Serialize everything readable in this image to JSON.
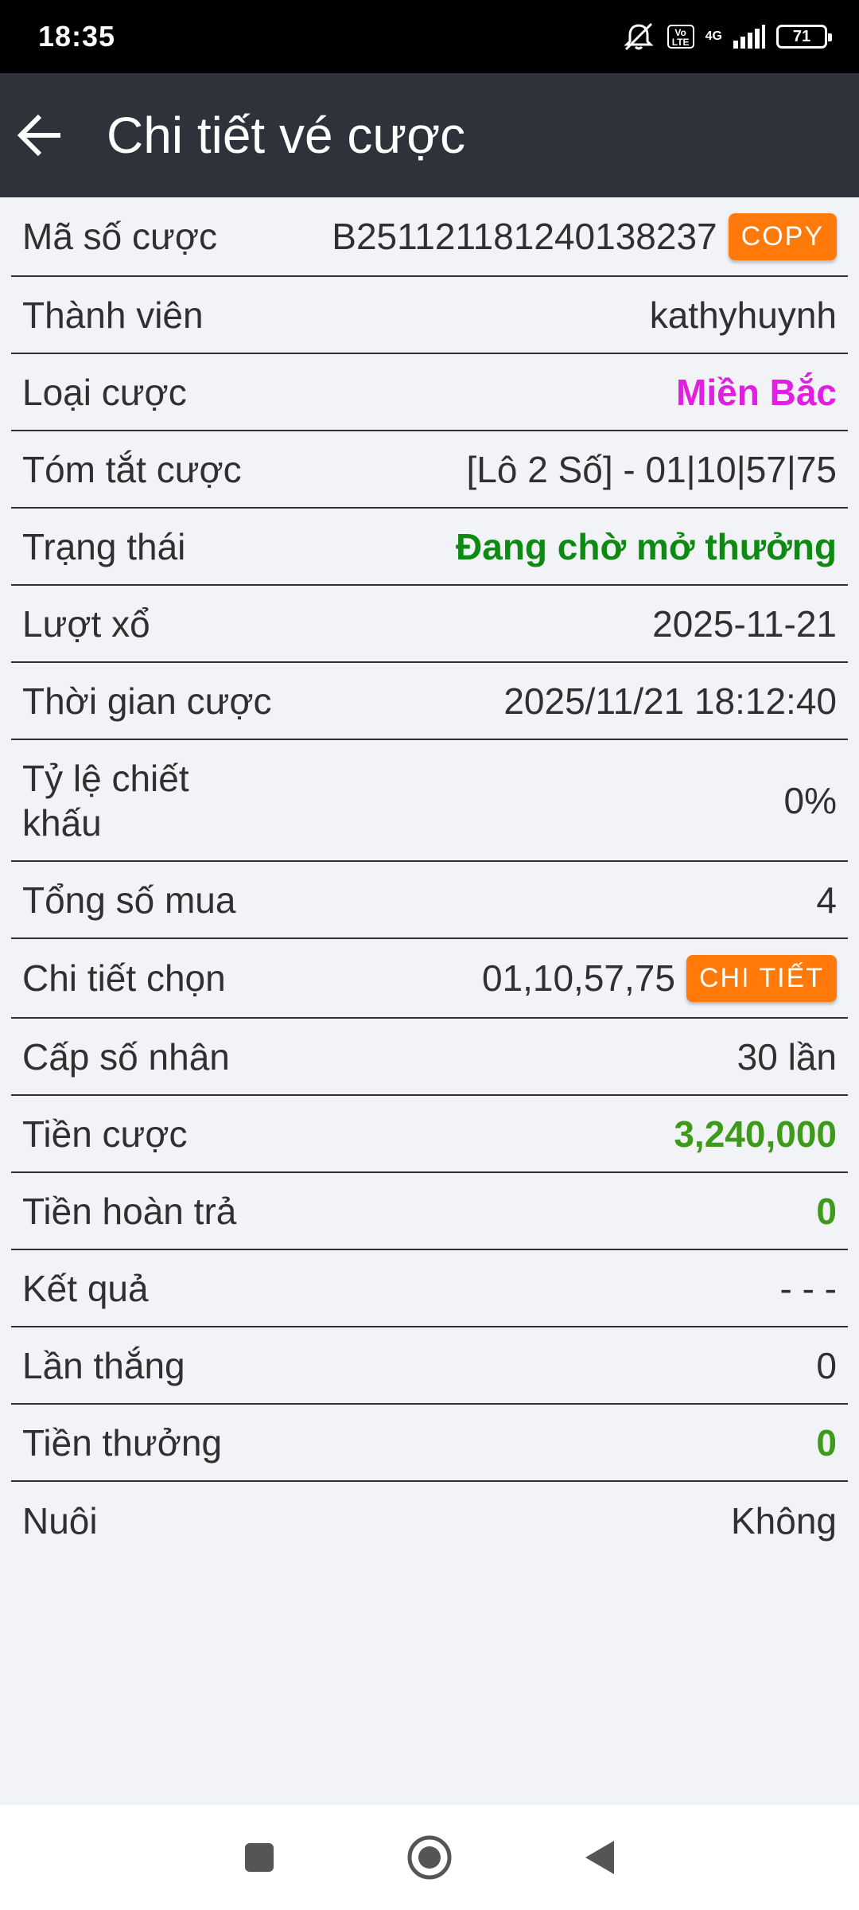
{
  "status_bar": {
    "time": "18:35",
    "network": "4G",
    "volte": "Vo LTE",
    "battery": "71",
    "icons": [
      "mute-icon",
      "volte-icon",
      "signal-icon",
      "battery-icon"
    ]
  },
  "app_bar": {
    "title": "Chi tiết vé cược",
    "back_icon": "arrow-left-icon"
  },
  "details": {
    "bet_code": {
      "label": "Mã số cược",
      "value": "B251121181240138237",
      "button": "COPY"
    },
    "member": {
      "label": "Thành viên",
      "value": "kathyhuynh"
    },
    "bet_type": {
      "label": "Loại cược",
      "value": "Miền Bắc"
    },
    "bet_summary": {
      "label": "Tóm tắt cược",
      "value": "[Lô 2 Số] - 01|10|57|75"
    },
    "status": {
      "label": "Trạng thái",
      "value": "Đang chờ mở thưởng"
    },
    "draw": {
      "label": "Lượt xổ",
      "value": "2025-11-21"
    },
    "bet_time": {
      "label": "Thời gian cược",
      "value": "2025/11/21 18:12:40"
    },
    "discount": {
      "label": "Tỷ lệ chiết khấu",
      "value": "0%"
    },
    "total_bought": {
      "label": "Tổng số mua",
      "value": "4"
    },
    "selection": {
      "label": "Chi tiết chọn",
      "value": "01,10,57,75",
      "button": "CHI TIẾT"
    },
    "multiplier": {
      "label": "Cấp số nhân",
      "value": "30 lần"
    },
    "stake": {
      "label": "Tiền cược",
      "value": "3,240,000"
    },
    "refund": {
      "label": "Tiền hoàn trả",
      "value": "0"
    },
    "result": {
      "label": "Kết quả",
      "value": "- - -"
    },
    "wins": {
      "label": "Lần thắng",
      "value": "0"
    },
    "prize": {
      "label": "Tiền thưởng",
      "value": "0"
    },
    "nuoi": {
      "label": "Nuôi",
      "value": "Không"
    }
  },
  "colors": {
    "app_bar": "#2e333b",
    "accent_button": "#ff7a0a",
    "bet_type": "#e01fe0",
    "status": "#0d8a12",
    "money": "#3d9a1a"
  },
  "nav_bar": {
    "icons": [
      "recents-square-icon",
      "home-circle-icon",
      "back-triangle-icon"
    ]
  }
}
